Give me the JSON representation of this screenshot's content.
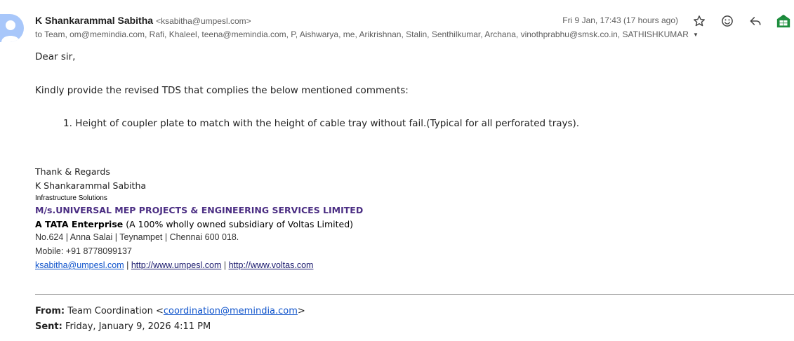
{
  "header": {
    "sender_name": "K Shankarammal Sabitha",
    "sender_email": "<ksabitha@umpesl.com>",
    "date": "Fri 9 Jan, 17:43 (17 hours ago)",
    "recipients": "to Team, om@memindia.com, Rafi, Khaleel, teena@memindia.com, P, Aishwarya, me, Arikrishnan, Stalin, Senthilkumar, Archana, vinothprabhu@smsk.co.in, SATHISHKUMAR",
    "icons": [
      "star-icon",
      "emoji-icon",
      "reply-icon",
      "sheets-app-icon"
    ]
  },
  "body": {
    "greeting": "Dear sir,",
    "intro": "Kindly provide the revised TDS that complies the below mentioned comments:",
    "list_marker": "1.",
    "list_item": "Height of coupler plate to match with the height of cable tray without fail.(Typical for all perforated trays)."
  },
  "signature": {
    "regards": "Thank & Regards",
    "name": "K Shankarammal Sabitha",
    "department": "Infrastructure Solutions",
    "company": "M/s.UNIVERSAL MEP PROJECTS & ENGINEERING SERVICES LIMITED",
    "tata_bold": "A TATA Enterprise",
    "tata_rest": " (A 100% wholly owned subsidiary of Voltas Limited)",
    "address": "No.624 | Anna Salai | Teynampet | Chennai 600 018.",
    "mobile": "Mobile: +91 8778099137",
    "link_email": "ksabitha@umpesl.com",
    "separator": " | ",
    "link_umpesl": "http://www.umpesl.com",
    "link_voltas": "http://www.voltas.com"
  },
  "quoted": {
    "from_label": "From:",
    "from_name": " Team Coordination <",
    "from_email": "coordination@memindia.com",
    "from_close": ">",
    "sent_label": "Sent:",
    "sent_value": " Friday, January 9, 2026 4:11 PM"
  }
}
